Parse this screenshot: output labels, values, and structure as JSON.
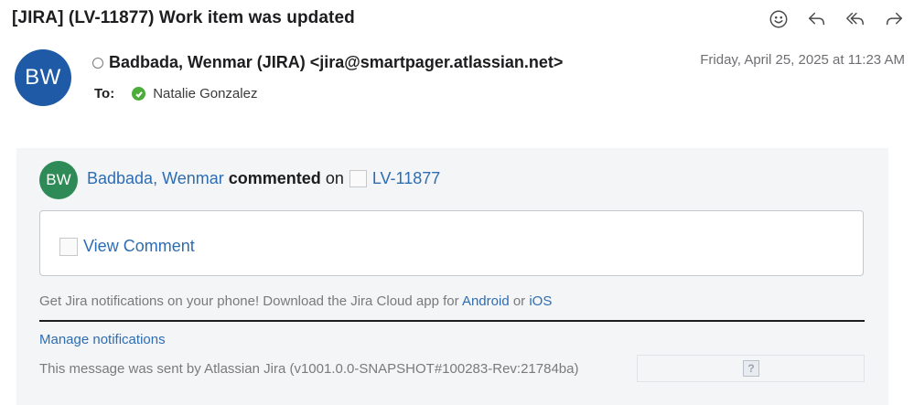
{
  "email": {
    "subject": "[JIRA] (LV-11877) Work item was updated",
    "sender_initials": "BW",
    "sender": "Badbada, Wenmar (JIRA) <jira@smartpager.atlassian.net>",
    "date": "Friday, April 25, 2025 at 11:23 AM",
    "to_label": "To:",
    "recipient": "Natalie Gonzalez"
  },
  "toolbar": {
    "icons": [
      "smiley-icon",
      "reply-icon",
      "reply-all-icon",
      "forward-icon"
    ]
  },
  "body": {
    "avatar_initials": "BW",
    "author": "Badbada, Wenmar",
    "action": "commented",
    "preposition": "on",
    "issue_key": "LV-11877",
    "view_comment": "View Comment",
    "promo_text": "Get Jira notifications on your phone! Download the Jira Cloud app for",
    "promo_android": "Android",
    "promo_or": "or",
    "promo_ios": "iOS",
    "manage_notifications": "Manage notifications",
    "footer": "This message was sent by Atlassian Jira (v1001.0.0-SNAPSHOT#100283-Rev:21784ba)",
    "help_glyph": "?"
  },
  "colors": {
    "avatar_header": "#1f5aa6",
    "avatar_body": "#2e8b57",
    "link": "#2d6db2",
    "presence_green": "#4cad3a",
    "panel_bg": "#f4f5f7"
  }
}
